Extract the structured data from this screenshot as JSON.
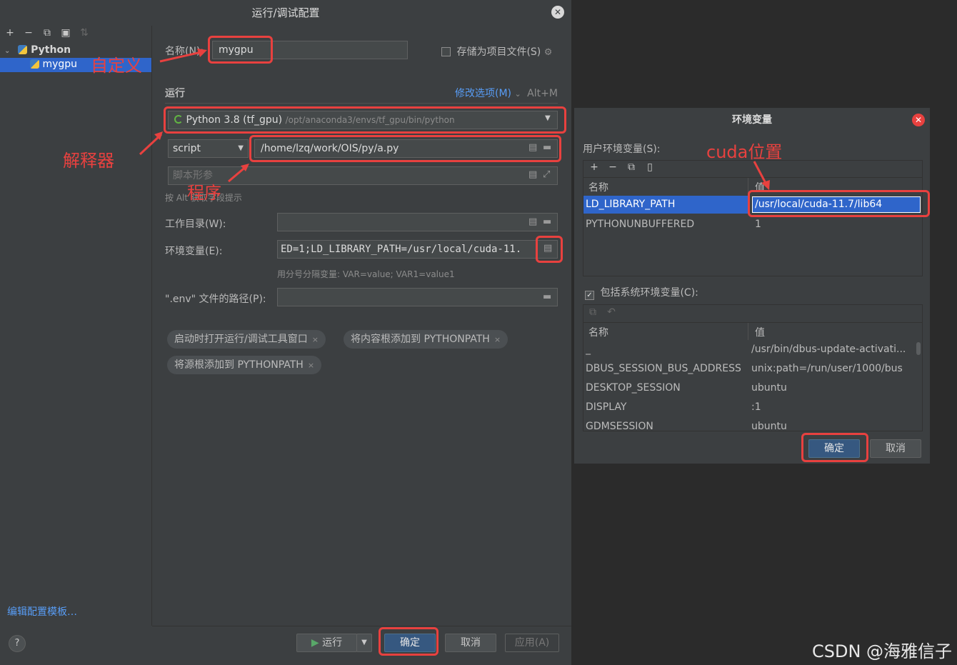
{
  "main_dialog": {
    "title": "运行/调试配置",
    "close": "✕",
    "toolbar_icons": [
      "+",
      "−",
      "⧉",
      "▣",
      "⇅"
    ],
    "tree": {
      "group": "Python",
      "child": "mygpu"
    },
    "edit_templates_link": "编辑配置模板…",
    "help": "?",
    "name_label": "名称(N):",
    "name_value": "mygpu",
    "store_as_project_file": "存储为项目文件(S)",
    "run_section": "运行",
    "modify_options": "修改选项(M)",
    "modify_shortcut": "Alt+M",
    "interpreter": {
      "name": "Python 3.8 (tf_gpu)",
      "path": "/opt/anaconda3/envs/tf_gpu/bin/python"
    },
    "script_type": "script",
    "script_path": "/home/lzq/work/OIS/py/a.py",
    "script_params_placeholder": "脚本形参",
    "alt_hint": "按 Alt 获取字段提示",
    "workdir_label": "工作目录(W):",
    "env_label": "环境变量(E):",
    "env_value": "ED=1;LD_LIBRARY_PATH=/usr/local/cuda-11.",
    "env_hint": "用分号分隔变量: VAR=value; VAR1=value1",
    "dotenv_label": "\".env\" 文件的路径(P):",
    "chips": [
      "启动时打开运行/调试工具窗口",
      "将内容根添加到 PYTHONPATH",
      "将源根添加到 PYTHONPATH"
    ],
    "chip_close": "×",
    "buttons": {
      "run": "运行",
      "ok": "确定",
      "cancel": "取消",
      "apply": "应用(A)"
    }
  },
  "env_dialog": {
    "title": "环境变量",
    "close": "✕",
    "user_vars_label": "用户环境变量(S):",
    "toolbar_icons": [
      "+",
      "−",
      "⧉",
      "▯"
    ],
    "col_name": "名称",
    "col_value": "值",
    "user_vars": [
      {
        "name": "LD_LIBRARY_PATH",
        "value": "/usr/local/cuda-11.7/lib64"
      },
      {
        "name": "PYTHONUNBUFFERED",
        "value": "1"
      }
    ],
    "include_system": "包括系统环境变量(C):",
    "system_toolbar_icons": [
      "⧉",
      "↶"
    ],
    "system_vars": [
      {
        "name": "_",
        "value": "/usr/bin/dbus-update-activati..."
      },
      {
        "name": "DBUS_SESSION_BUS_ADDRESS",
        "value": "unix:path=/run/user/1000/bus"
      },
      {
        "name": "DESKTOP_SESSION",
        "value": "ubuntu"
      },
      {
        "name": "DISPLAY",
        "value": ":1"
      },
      {
        "name": "GDMSESSION",
        "value": "ubuntu"
      }
    ],
    "buttons": {
      "ok": "确定",
      "cancel": "取消"
    }
  },
  "annotations": {
    "custom": "自定义",
    "interpreter": "解释器",
    "program": "程序",
    "cuda": "cuda位置"
  },
  "watermark": "CSDN @海雅信子",
  "colors": {
    "annotation_red": "#e8413f",
    "selection_blue": "#2f65ca",
    "primary_button": "#365880",
    "link_blue": "#589df6"
  }
}
